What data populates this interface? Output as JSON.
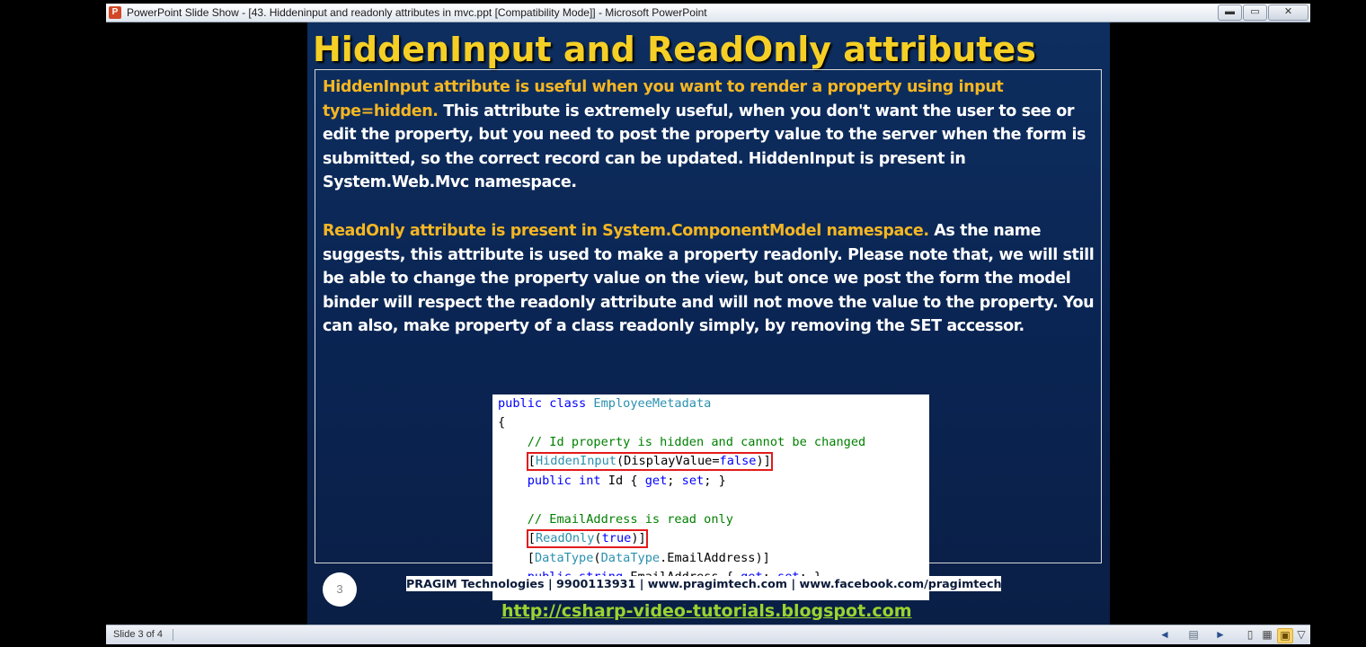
{
  "window": {
    "title": "PowerPoint Slide Show - [43. Hiddeninput and readonly attributes in mvc.ppt [Compatibility Mode]] - Microsoft PowerPoint",
    "app_icon_letter": "P",
    "minimize_glyph": "▬",
    "maximize_glyph": "▭",
    "close_glyph": "✕"
  },
  "slide": {
    "title": "HiddenInput and ReadOnly attributes",
    "para1": {
      "highlight": "HiddenInput attribute is useful when you want to render a property using input type=hidden.",
      "rest": " This attribute is extremely useful, when you don't want the user to see or edit the property, but you need to post the property value to the server when the form is submitted, so the correct record can be updated. HiddenInput is present in System.Web.Mvc namespace."
    },
    "para2": {
      "highlight": "ReadOnly attribute is present in System.ComponentModel namespace.",
      "rest": " As the name suggests, this attribute is used to make a property readonly. Please note that, we will still be able to change the property value on the view, but once we post the form the model binder will respect the readonly attribute and will not move the value to the property.  You can also, make property of a class readonly simply, by removing the SET accessor."
    },
    "code": {
      "l1_kw1": "public",
      "l1_kw2": "class",
      "l1_type": "EmployeeMetadata",
      "l2": "{",
      "l3_comment": "// Id property is hidden and cannot be changed",
      "l4_open": "[",
      "l4_type": "HiddenInput",
      "l4_mid": "(DisplayValue=",
      "l4_kw": "false",
      "l4_close": ")]",
      "l5_kw1": "public",
      "l5_kw2": "int",
      "l5_mid": " Id { ",
      "l5_kw3": "get",
      "l5_semi": "; ",
      "l5_kw4": "set",
      "l5_end": "; }",
      "l7_comment": "// EmailAddress is read only",
      "l8_open": "[",
      "l8_type": "ReadOnly",
      "l8_p1": "(",
      "l8_kw": "true",
      "l8_close": ")]",
      "l9_open": "[",
      "l9_type1": "DataType",
      "l9_p1": "(",
      "l9_type2": "DataType",
      "l9_rest": ".EmailAddress)]",
      "l10_kw1": "public",
      "l10_kw2": "string",
      "l10_mid": " EmailAddress { ",
      "l10_kw3": "get",
      "l10_semi": "; ",
      "l10_kw4": "set",
      "l10_end": "; }"
    },
    "page_number": "3",
    "footer": "PRAGIM Technologies | 9900113931 | www.pragimtech.com | www.facebook.com/pragimtech",
    "blog_link": "http://csharp-video-tutorials.blogspot.com"
  },
  "statusbar": {
    "slide_indicator": "Slide 3 of 4",
    "prev_glyph": "◄",
    "menu_glyph": "▤",
    "next_glyph": "►",
    "normal_glyph": "▯",
    "sorter_glyph": "▦",
    "reading_glyph": "▣",
    "show_glyph": "▽"
  },
  "colors": {
    "slide_bg": "#0d2e5f",
    "title": "#f5cf25",
    "highlight_text": "#f5b622",
    "body_text": "#ffffff",
    "link": "#9ad430",
    "code_keyword": "#0000ff",
    "code_type": "#2b91af",
    "code_comment": "#008000",
    "code_highlight_box": "#e21b1b"
  }
}
